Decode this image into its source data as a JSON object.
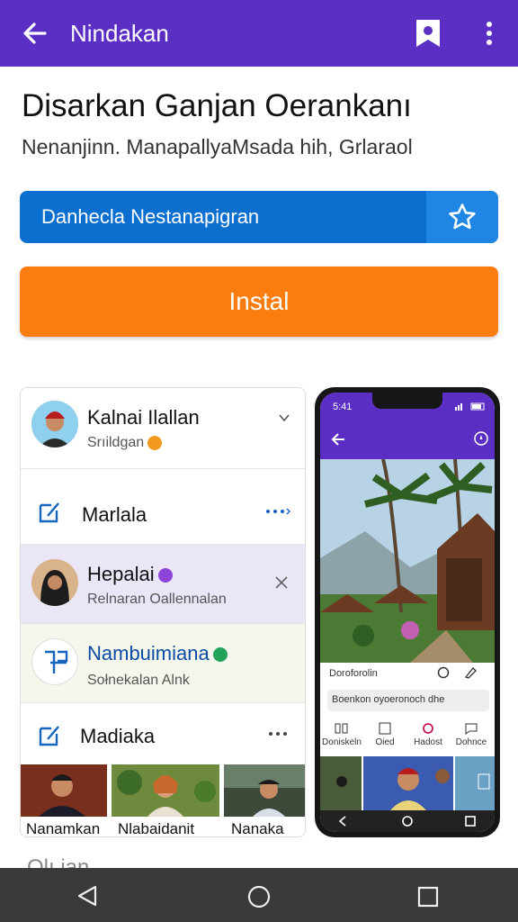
{
  "appbar": {
    "title": "Nindakan",
    "back_icon": "arrow-left-icon",
    "bookmark_icon": "bookmark-icon",
    "more_icon": "more-vertical-icon",
    "color": "#5b2fc4"
  },
  "header": {
    "title": "Disarkan Ganjan Oerankanı",
    "subtitle": "Nenanjinn. ManapallyaMsada hih, Grlaraol"
  },
  "buttons": {
    "primary_label": "Danhecla Nestanapigran",
    "star_icon": "star-outline-icon",
    "install_label": "Instal",
    "blue": "#0a6fcf",
    "orange": "#fb7d10"
  },
  "list": {
    "items": [
      {
        "name": "Kalnai Ilallan",
        "sub": "Srıildgan",
        "trailing": "chevron-down-icon"
      },
      {
        "name": "Marlala",
        "sub": "",
        "trailing": "more-horizontal-icon"
      },
      {
        "name": "Hepalai",
        "sub": "Relnaran Oallennalan",
        "trailing": "close-icon"
      },
      {
        "name": "Nambuimiana",
        "sub": "Sołnekalan Alnk",
        "trailing": ""
      },
      {
        "name": "Madiaka",
        "sub": "",
        "trailing": "more-horizontal-icon"
      }
    ],
    "thumbnails": [
      "Nanamkan",
      "Nlabaidanit",
      "Nanaka"
    ]
  },
  "phone": {
    "status_time": "5:41",
    "caption": "Doroforolin",
    "input_value": "Boenkon oyoeronoch dhe",
    "tabs": [
      "Doniskeln",
      "Oied",
      "Hadost",
      "Dohnce"
    ]
  },
  "cutoff_text": "Olı.ian",
  "navbar": {
    "back_icon": "nav-back-icon",
    "home_icon": "nav-home-icon",
    "recents_icon": "nav-recents-icon"
  }
}
